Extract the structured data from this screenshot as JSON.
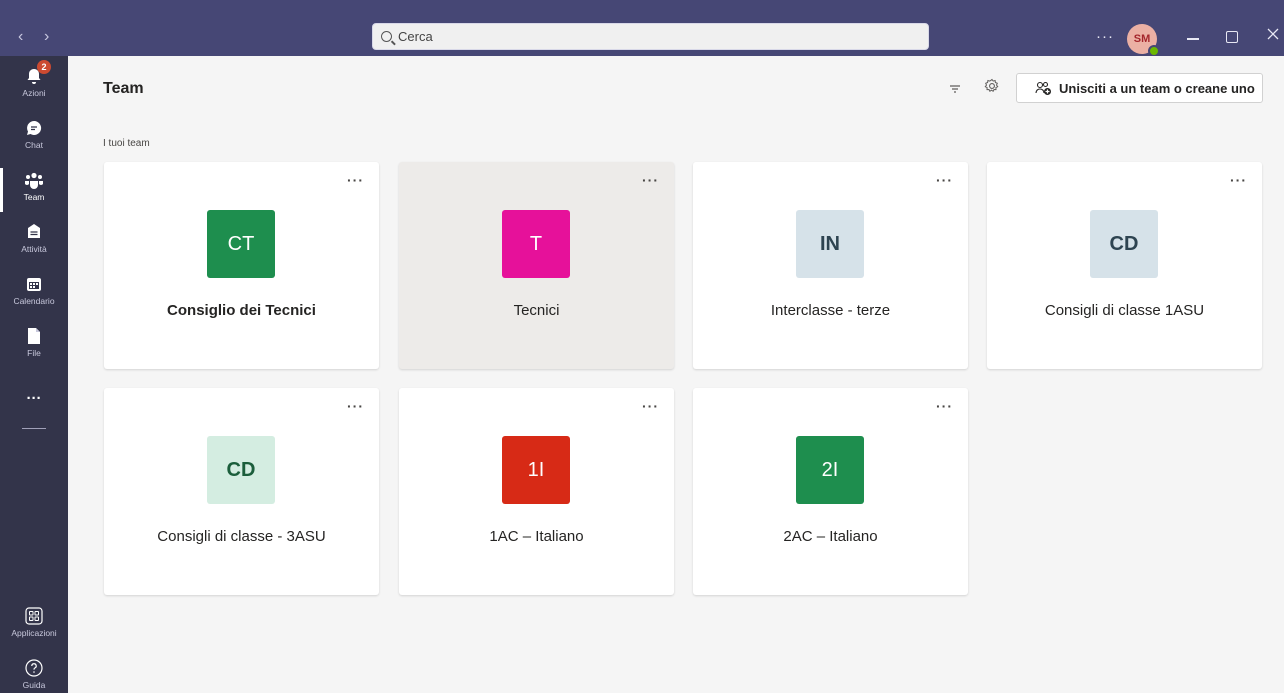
{
  "titlebar": {
    "search_placeholder": "Cerca",
    "more": "···",
    "avatar_initials": "SM"
  },
  "rail": [
    {
      "label": "Azioni",
      "badge": "2"
    },
    {
      "label": "Chat"
    },
    {
      "label": "Team"
    },
    {
      "label": "Attività"
    },
    {
      "label": "Calendario"
    },
    {
      "label": "File"
    },
    {
      "label": "···"
    },
    {
      "label": "Applicazioni"
    },
    {
      "label": "Guida"
    }
  ],
  "header": {
    "title": "Team",
    "join_label": "Unisciti a un team o creane uno"
  },
  "section_label": "I tuoi team",
  "teams": [
    {
      "initials": "CT",
      "name": "Consiglio dei Tecnici",
      "tile_bg": "#1e8e4e",
      "tile_fg": "#ffffff"
    },
    {
      "initials": "T",
      "name": "Tecnici",
      "tile_bg": "#e6119a",
      "tile_fg": "#ffffff"
    },
    {
      "initials": "IN",
      "name": "Interclasse - terze",
      "tile_bg": "#d6e2e9",
      "tile_fg": "#2e4451"
    },
    {
      "initials": "CD",
      "name": "Consigli di classe 1ASU",
      "tile_bg": "#d6e2e9",
      "tile_fg": "#2e4451"
    },
    {
      "initials": "CD",
      "name": "Consigli di classe - 3ASU",
      "tile_bg": "#d4ede1",
      "tile_fg": "#1b5e3b"
    },
    {
      "initials": "1I",
      "name": "1AC – Italiano",
      "tile_bg": "#d72a16",
      "tile_fg": "#ffffff"
    },
    {
      "initials": "2I",
      "name": "2AC – Italiano",
      "tile_bg": "#1e8e4e",
      "tile_fg": "#ffffff"
    }
  ],
  "card_more": "···",
  "colors": {
    "titlebar": "#464775",
    "rail": "#33344a",
    "accent": "#6264a7"
  }
}
